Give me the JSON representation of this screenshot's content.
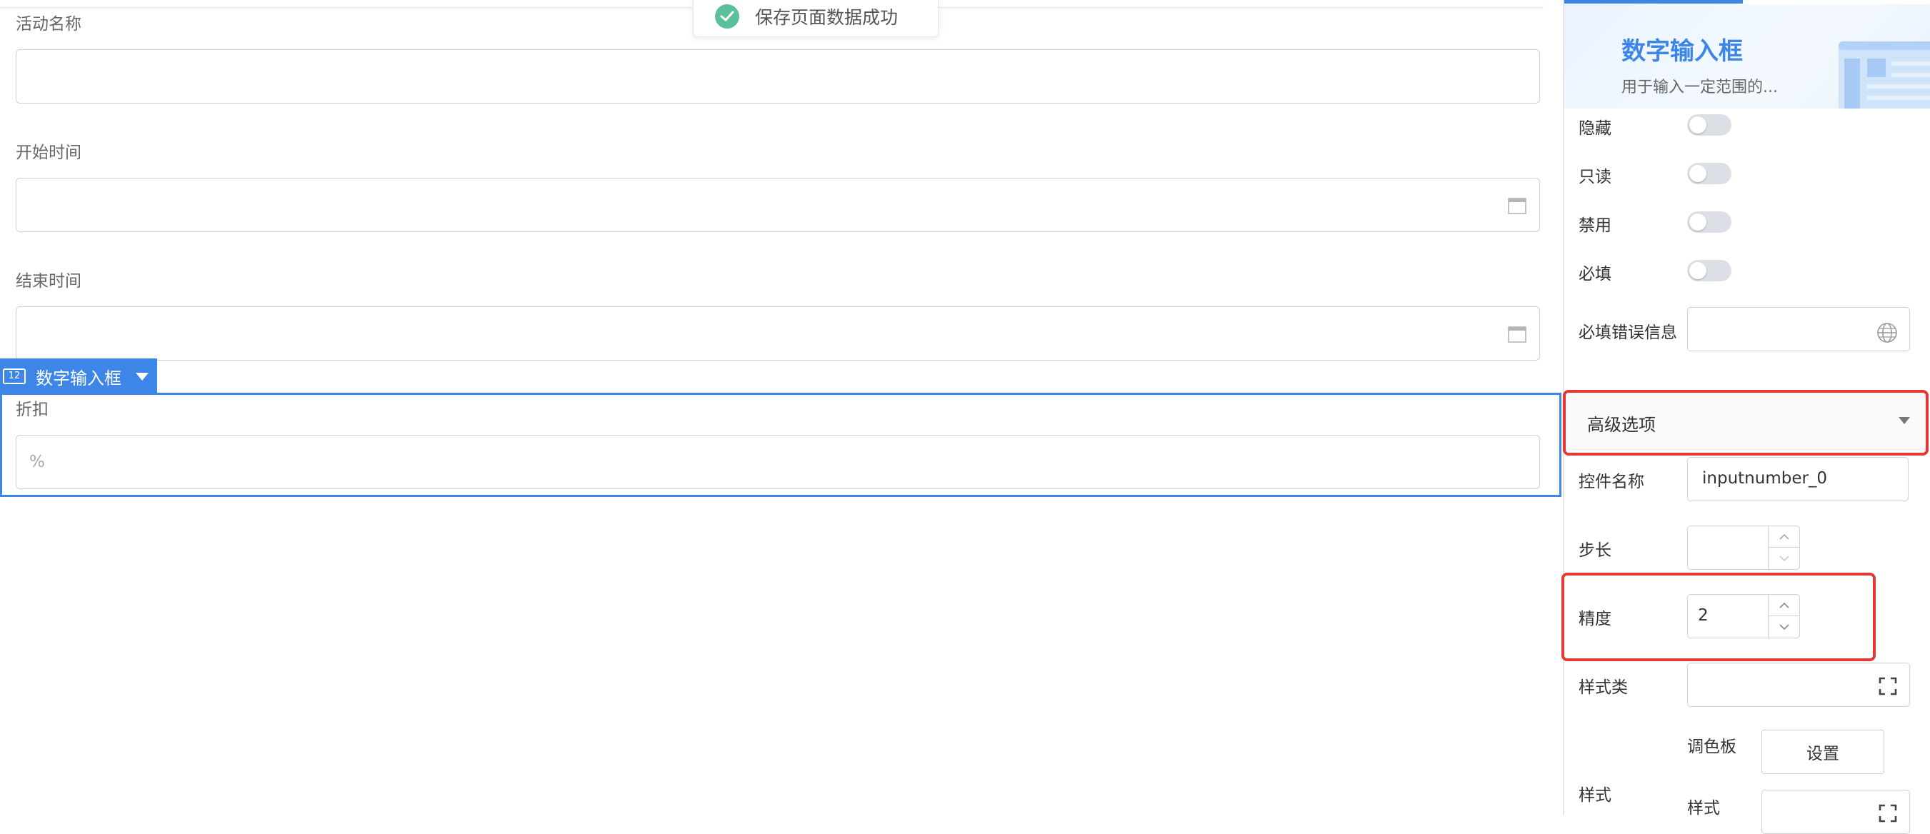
{
  "toast": {
    "text": "保存页面数据成功"
  },
  "form": {
    "fields": [
      {
        "label": "活动名称"
      },
      {
        "label": "开始时间"
      },
      {
        "label": "结束时间"
      },
      {
        "label": "折扣",
        "placeholder": "%"
      }
    ],
    "selected_component": {
      "tag_label": "数字输入框",
      "tag_icon_text": "12"
    }
  },
  "panel": {
    "banner": {
      "title": "数字输入框",
      "subtitle": "用于输入一定范围的..."
    },
    "toggles": [
      {
        "label": "隐藏",
        "on": false
      },
      {
        "label": "只读",
        "on": false
      },
      {
        "label": "禁用",
        "on": false
      },
      {
        "label": "必填",
        "on": false
      }
    ],
    "required_error_label": "必填错误信息",
    "advanced": {
      "label": "高级选项"
    },
    "control_name": {
      "label": "控件名称",
      "value": "inputnumber_0"
    },
    "step": {
      "label": "步长",
      "value": ""
    },
    "precision": {
      "label": "精度",
      "value": "2"
    },
    "style_class": {
      "label": "样式类"
    },
    "style": {
      "label": "样式",
      "palette_label": "调色板",
      "settings_button": "设置",
      "style_sub_label": "样式"
    }
  },
  "colors": {
    "accent": "#3d86e8",
    "highlight": "#e53935",
    "success": "#5cc09a"
  }
}
